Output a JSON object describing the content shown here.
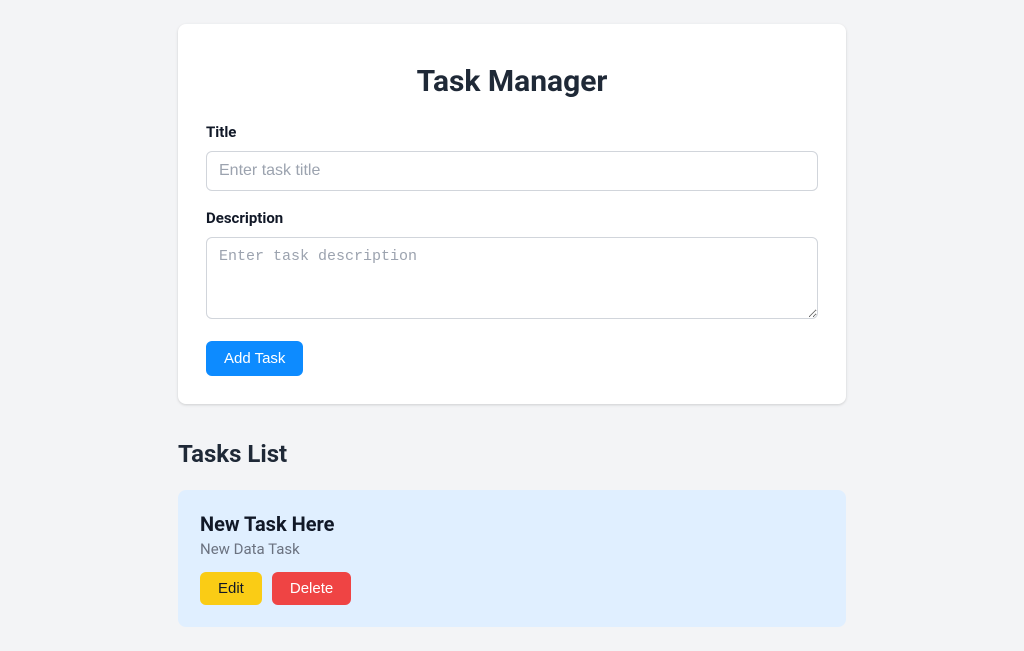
{
  "header": {
    "title": "Task Manager"
  },
  "form": {
    "title_label": "Title",
    "title_placeholder": "Enter task title",
    "title_value": "",
    "description_label": "Description",
    "description_placeholder": "Enter task description",
    "description_value": "",
    "add_button_label": "Add Task"
  },
  "list": {
    "section_title": "Tasks List",
    "tasks": [
      {
        "title": "New Task Here",
        "description": "New Data Task",
        "edit_label": "Edit",
        "delete_label": "Delete"
      }
    ]
  }
}
